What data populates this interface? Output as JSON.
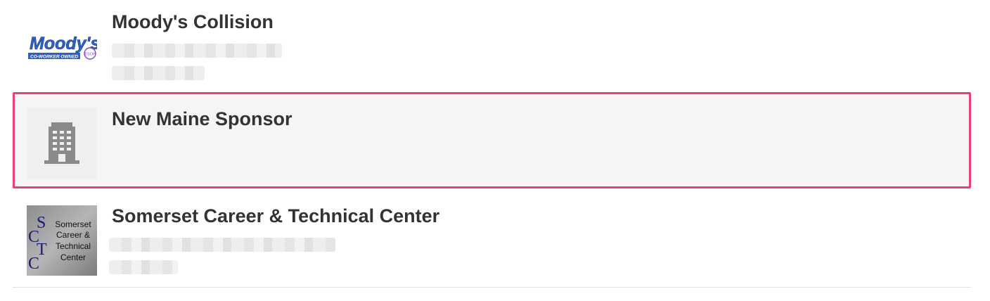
{
  "sponsors": [
    {
      "name": "Moody's Collision",
      "logo_text": "Moody's",
      "logo_tagline": "CO-WORKER OWNED",
      "logo_badge": "ESOP",
      "has_redacted_details": true
    },
    {
      "name": "New Maine Sponsor",
      "logo_icon": "building-icon",
      "selected": true,
      "highlight_color": "#e8407a"
    },
    {
      "name": "Somerset Career & Technical Center",
      "logo_letters": [
        "S",
        "C",
        "T",
        "C"
      ],
      "logo_lines": [
        "Somerset",
        "Career &",
        "Technical",
        "Center"
      ],
      "has_redacted_details": true
    }
  ]
}
